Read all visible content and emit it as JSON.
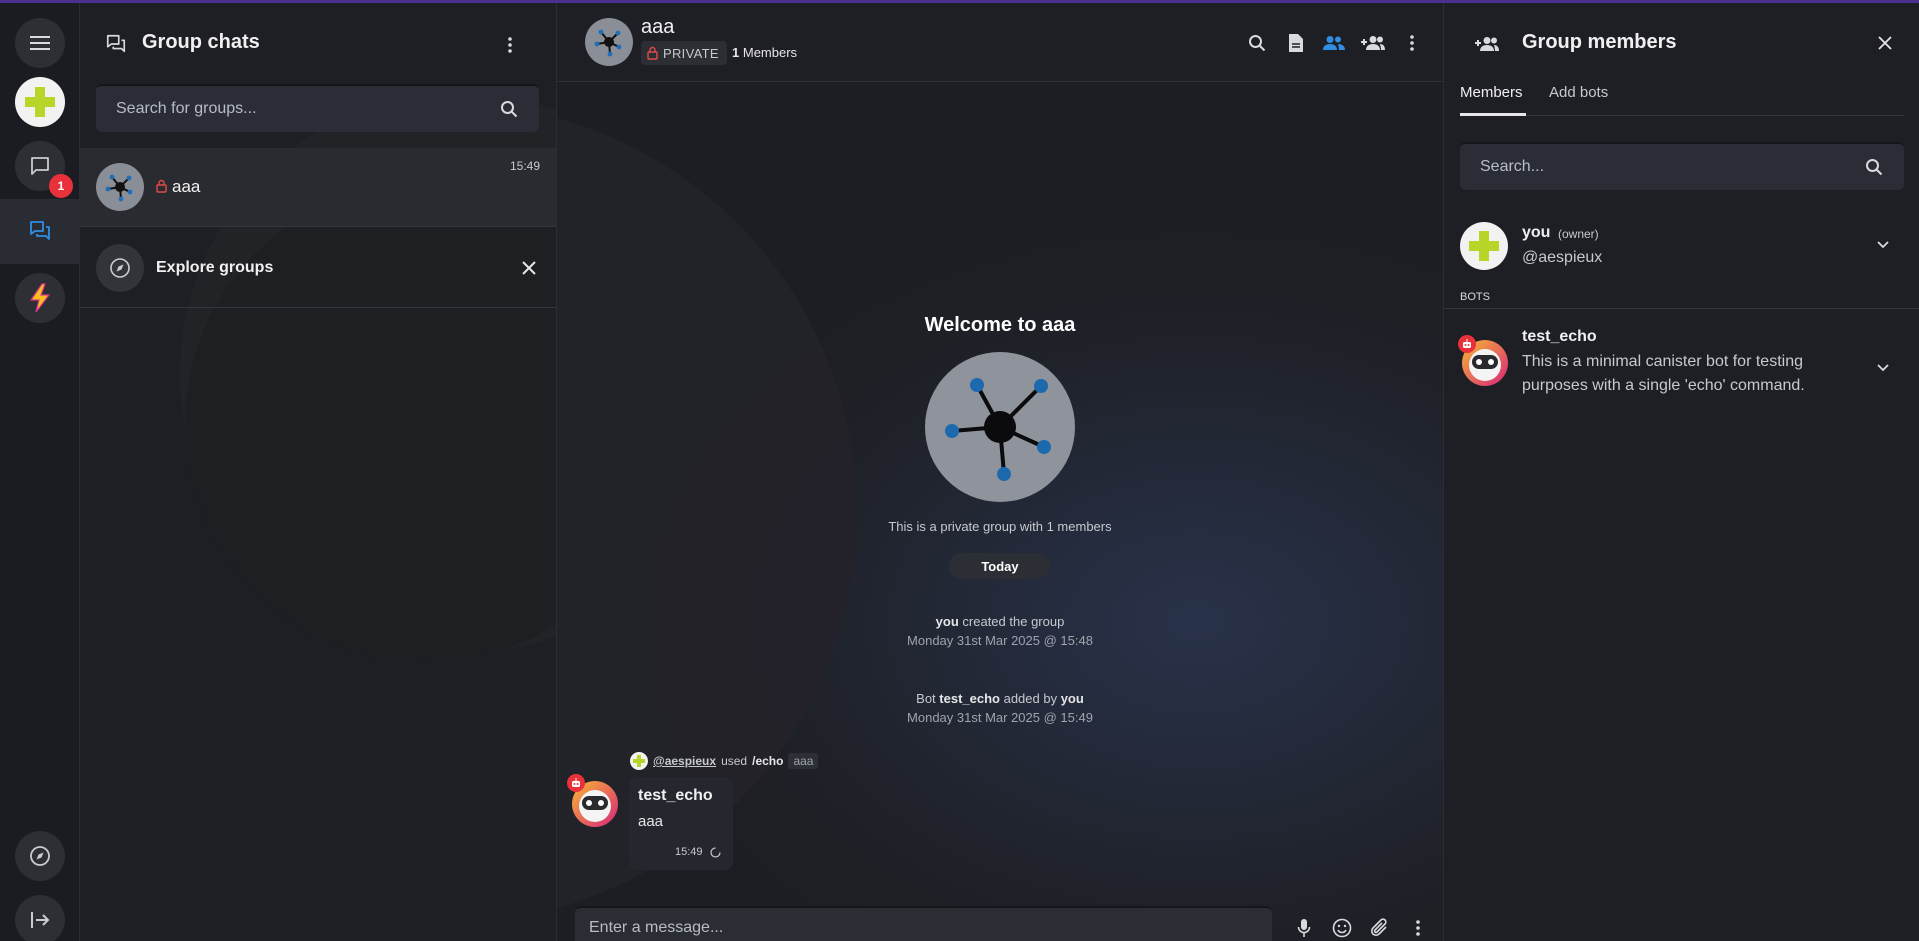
{
  "left_rail": {
    "unread_badge": "1"
  },
  "group_chats": {
    "title": "Group chats",
    "search_placeholder": "Search for groups...",
    "items": [
      {
        "name": "aaa",
        "time": "15:49",
        "private": true
      }
    ],
    "explore_label": "Explore groups"
  },
  "chat": {
    "name": "aaa",
    "private_label": "PRIVATE",
    "member_count": "1",
    "members_word": "Members",
    "welcome_title": "Welcome to aaa",
    "private_desc": "This is a private group with 1 members",
    "date_divider": "Today",
    "events": [
      {
        "actor": "you",
        "text": " created the group",
        "timestamp": "Monday 31st Mar 2025 @ 15:48"
      },
      {
        "prefix": "Bot ",
        "bot": "test_echo",
        "middle": " added by ",
        "actor": "you",
        "timestamp": "Monday 31st Mar 2025 @ 15:49"
      }
    ],
    "message": {
      "invoker": "@aespieux",
      "used_word": "used",
      "command": "/echo",
      "arg": "aaa",
      "sender": "test_echo",
      "text": "aaa",
      "time": "15:49"
    },
    "composer_placeholder": "Enter a message..."
  },
  "members_panel": {
    "title": "Group members",
    "tabs": [
      "Members",
      "Add bots"
    ],
    "search_placeholder": "Search...",
    "members": [
      {
        "name": "you",
        "role": "(owner)",
        "handle": "@aespieux"
      }
    ],
    "bots_label": "BOTS",
    "bots": [
      {
        "name": "test_echo",
        "description_line1": "This is a minimal canister bot for testing",
        "description_line2": "purposes with a single 'echo' command."
      }
    ]
  },
  "colors": {
    "accent_blue": "#2f8de4",
    "unread_red": "#e8313a",
    "lock_red": "#e04a4a",
    "avatar_green": "#b8d62a"
  }
}
